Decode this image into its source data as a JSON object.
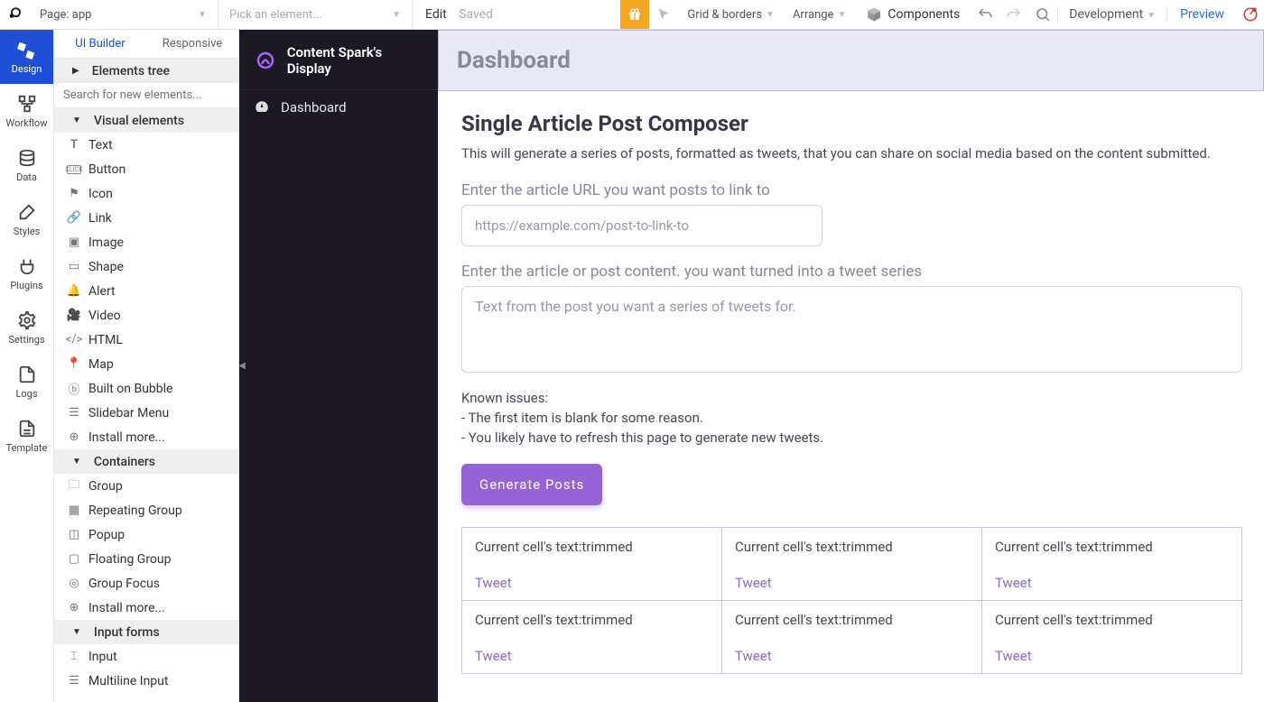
{
  "toolbar": {
    "page_label": "Page: app",
    "picker_placeholder": "Pick an element...",
    "edit": "Edit",
    "saved": "Saved",
    "grid_borders": "Grid & borders",
    "arrange": "Arrange",
    "components": "Components",
    "environment": "Development",
    "preview": "Preview"
  },
  "iconbar": {
    "design": "Design",
    "workflow": "Workflow",
    "data": "Data",
    "styles": "Styles",
    "plugins": "Plugins",
    "settings": "Settings",
    "logs": "Logs",
    "template": "Template"
  },
  "palette": {
    "tab_ui": "UI Builder",
    "tab_responsive": "Responsive",
    "elements_tree": "Elements tree",
    "search_placeholder": "Search for new elements...",
    "section_visual": "Visual elements",
    "items_visual": [
      "Text",
      "Button",
      "Icon",
      "Link",
      "Image",
      "Shape",
      "Alert",
      "Video",
      "HTML",
      "Map",
      "Built on Bubble",
      "Slidebar Menu",
      "Install more..."
    ],
    "section_containers": "Containers",
    "items_containers": [
      "Group",
      "Repeating Group",
      "Popup",
      "Floating Group",
      "Group Focus",
      "Install more..."
    ],
    "section_inputs": "Input forms",
    "items_inputs": [
      "Input",
      "Multiline Input"
    ]
  },
  "sidenav": {
    "brand": "Content Spark's Display",
    "dashboard": "Dashboard"
  },
  "content": {
    "header": "Dashboard",
    "title": "Single Article Post Composer",
    "desc": "This will generate a series of posts, formatted as tweets, that you can share on social media based on the content submitted.",
    "url_label": "Enter the article URL you want posts to link to",
    "url_placeholder": "https://example.com/post-to-link-to",
    "content_label": "Enter the article or post content. you want turned into a tweet series",
    "content_placeholder": "Text from the post you want a series of tweets for.",
    "issues_head": "Known issues:",
    "issue1": "- The first item is blank for some reason.",
    "issue2": "- You likely have to refresh this page to generate new tweets.",
    "generate": "Generate Posts",
    "cell_text": "Current cell's text:trimmed",
    "cell_link": "Tweet"
  }
}
